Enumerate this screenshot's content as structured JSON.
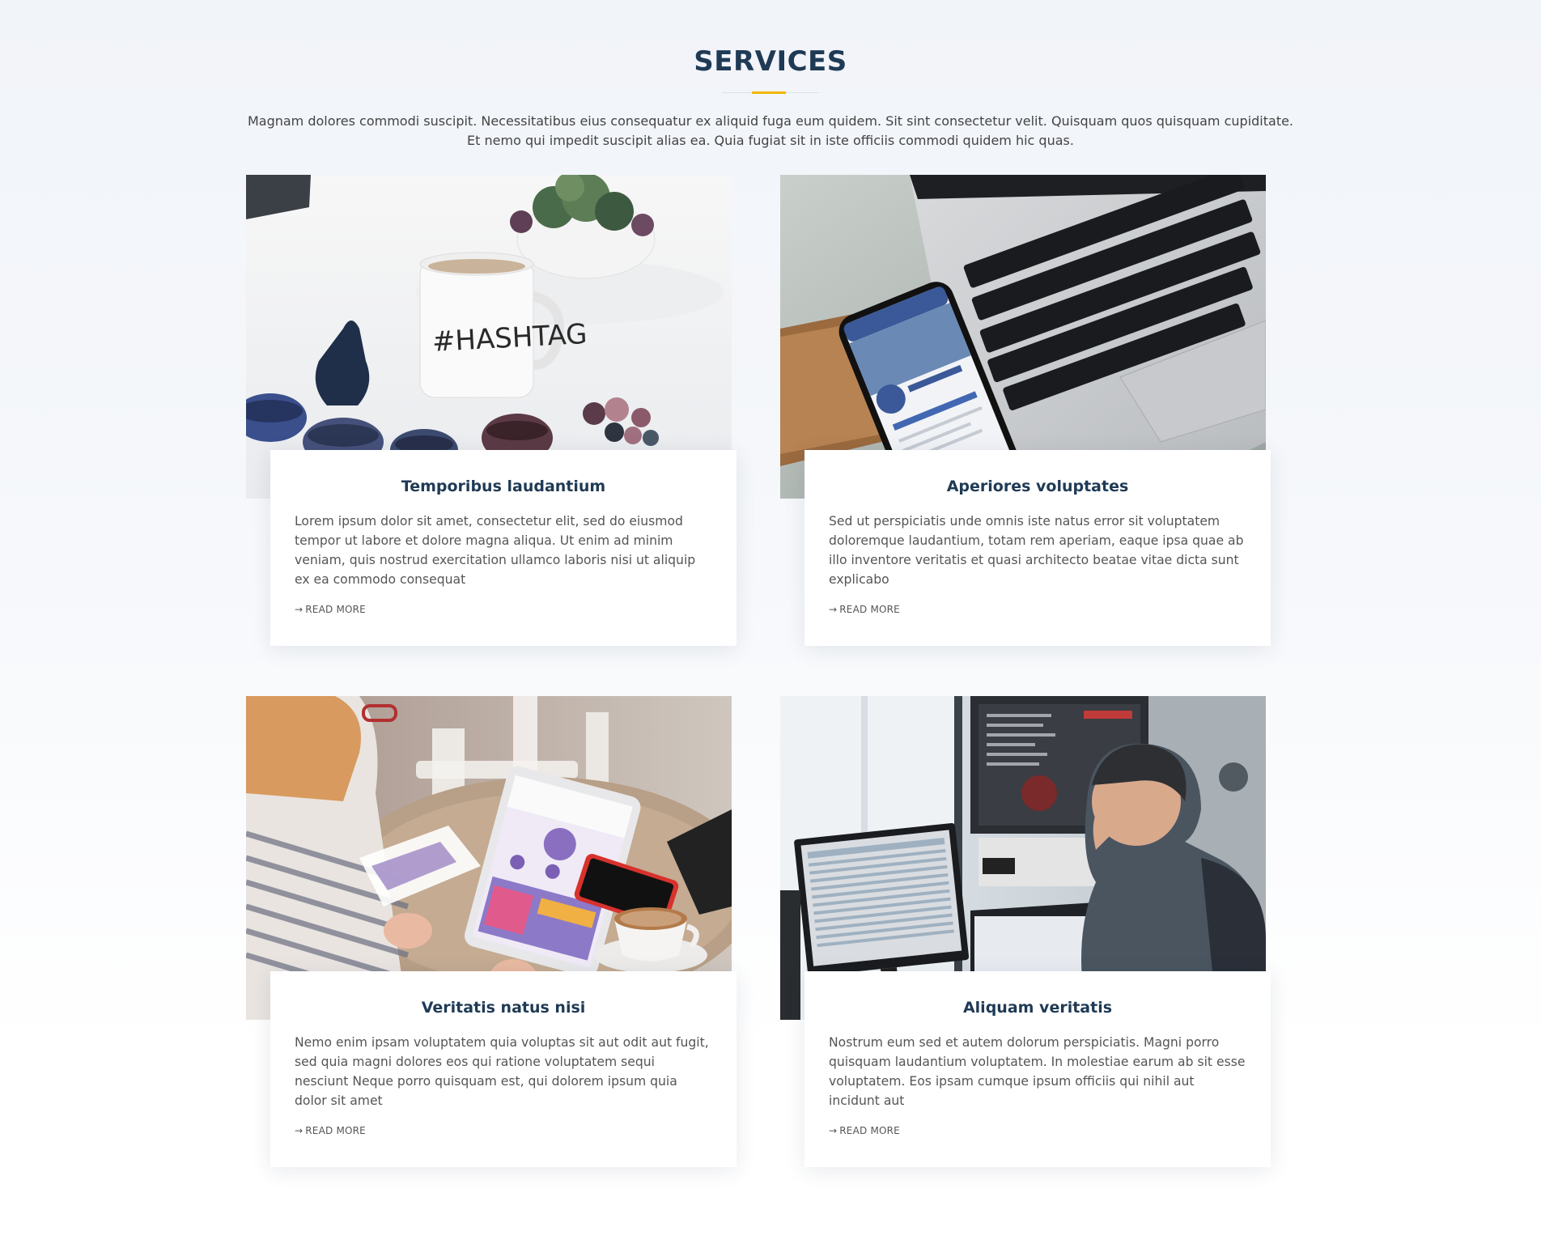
{
  "section": {
    "title": "SERVICES",
    "intro": "Magnam dolores commodi suscipit. Necessitatibus eius consequatur ex aliquid fuga eum quidem. Sit sint consectetur velit. Quisquam quos quisquam cupiditate. Et nemo qui impedit suscipit alias ea. Quia fugiat sit in iste officiis commodi quidem hic quas.",
    "accent_color": "#f2b705",
    "title_color": "#1f3a55"
  },
  "services": [
    {
      "title": "Temporibus laudantium",
      "text": "Lorem ipsum dolor sit amet, consectetur elit, sed do eiusmod tempor ut labore et dolore magna aliqua. Ut enim ad minim veniam, quis nostrud exercitation ullamco laboris nisi ut aliquip ex ea commodo consequat",
      "link": "READ MORE",
      "link_icon": "arrow-right-icon",
      "image_text": "#HASHTAG"
    },
    {
      "title": "Aperiores voluptates",
      "text": "Sed ut perspiciatis unde omnis iste natus error sit voluptatem doloremque laudantium, totam rem aperiam, eaque ipsa quae ab illo inventore veritatis et quasi architecto beatae vitae dicta sunt explicabo",
      "link": "READ MORE",
      "link_icon": "arrow-right-icon"
    },
    {
      "title": "Veritatis natus nisi",
      "text": "Nemo enim ipsam voluptatem quia voluptas sit aut odit aut fugit, sed quia magni dolores eos qui ratione voluptatem sequi nesciunt Neque porro quisquam est, qui dolorem ipsum quia dolor sit amet",
      "link": "READ MORE",
      "link_icon": "arrow-right-icon"
    },
    {
      "title": "Aliquam veritatis",
      "text": "Nostrum eum sed et autem dolorum perspiciatis. Magni porro quisquam laudantium voluptatem. In molestiae earum ab sit esse voluptatem. Eos ipsam cumque ipsum officiis qui nihil aut incidunt aut",
      "link": "READ MORE",
      "link_icon": "arrow-right-icon"
    }
  ]
}
